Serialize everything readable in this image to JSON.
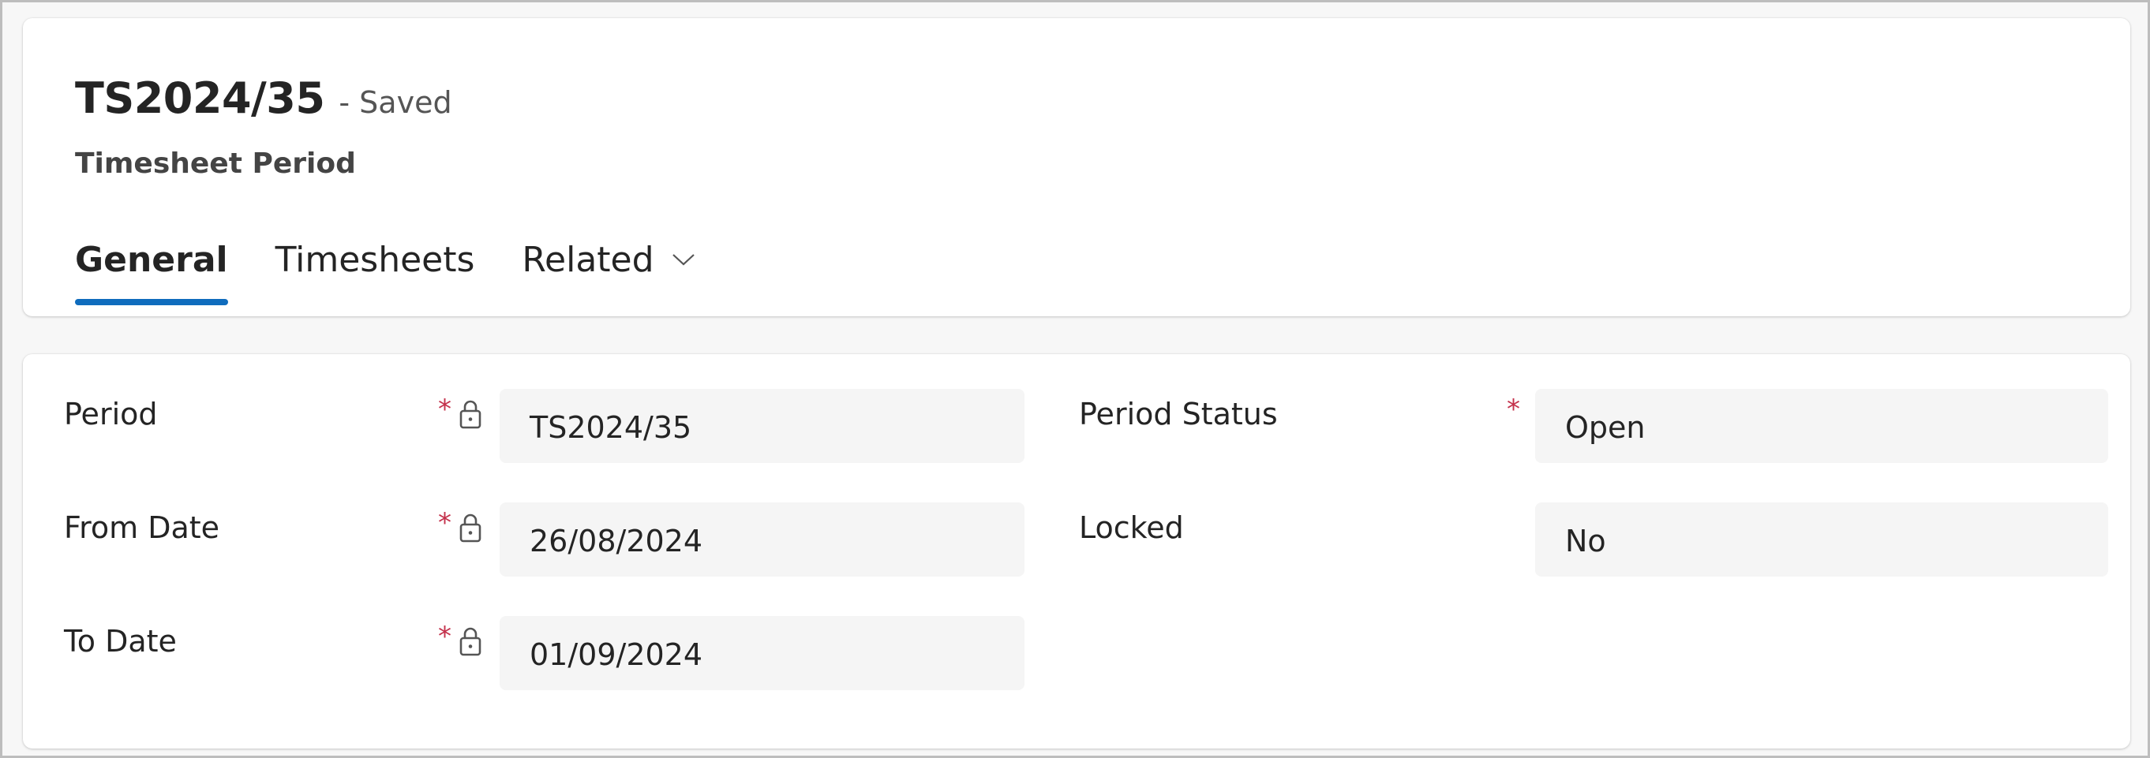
{
  "header": {
    "title": "TS2024/35",
    "save_status": "- Saved",
    "entity_name": "Timesheet Period"
  },
  "tabs": [
    {
      "label": "General",
      "active": true
    },
    {
      "label": "Timesheets",
      "active": false
    },
    {
      "label": "Related",
      "active": false,
      "has_dropdown": true
    }
  ],
  "form": {
    "left": [
      {
        "label": "Period",
        "required": "*",
        "locked": true,
        "value": "TS2024/35"
      },
      {
        "label": "From Date",
        "required": "*",
        "locked": true,
        "value": "26/08/2024"
      },
      {
        "label": "To Date",
        "required": "*",
        "locked": true,
        "value": "01/09/2024"
      }
    ],
    "right": [
      {
        "label": "Period Status",
        "required": "*",
        "locked": false,
        "value": "Open"
      },
      {
        "label": "Locked",
        "required": "",
        "locked": false,
        "value": "No"
      }
    ]
  },
  "colors": {
    "accent": "#0f6cbd",
    "required": "#c4314b",
    "field_bg": "#f5f5f5"
  }
}
